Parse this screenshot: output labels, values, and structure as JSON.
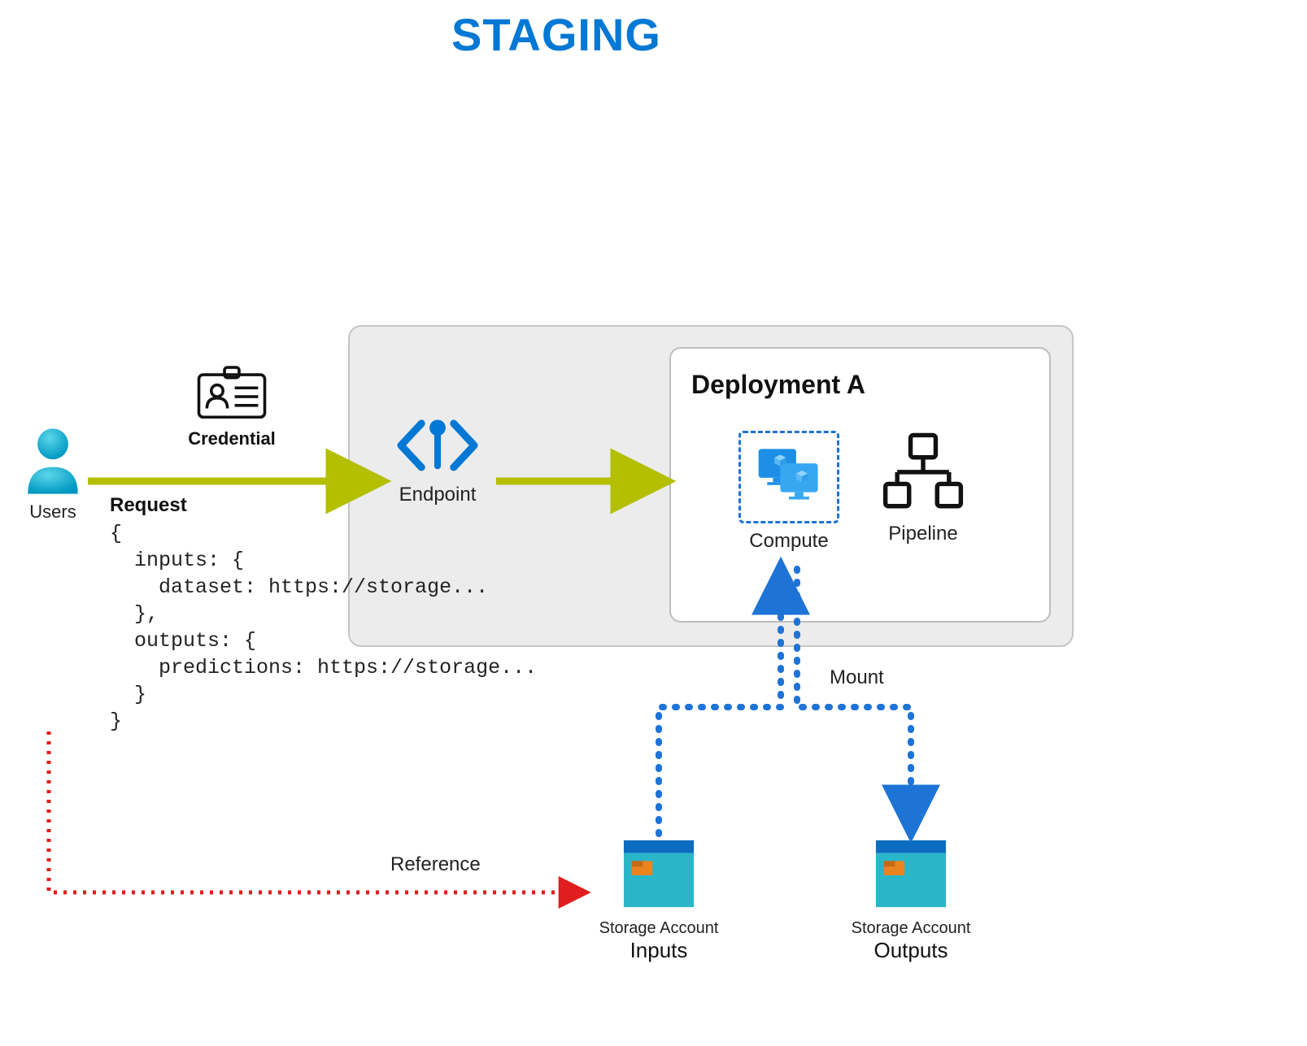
{
  "title": "STAGING",
  "users_label": "Users",
  "credential_label": "Credential",
  "endpoint_label": "Endpoint",
  "deployment_title": "Deployment A",
  "compute_label": "Compute",
  "pipeline_label": "Pipeline",
  "mount_label": "Mount",
  "reference_label": "Reference",
  "request_title": "Request",
  "request_body": "{\n  inputs: {\n    dataset: https://storage...\n  },\n  outputs: {\n    predictions: https://storage...\n  }\n}",
  "storage_in": {
    "top": "Storage Account",
    "bottom": "Inputs"
  },
  "storage_out": {
    "top": "Storage Account",
    "bottom": "Outputs"
  },
  "colors": {
    "accent_blue": "#0078D4",
    "olive_arrow": "#B3BF00",
    "red_dash": "#E01E1E",
    "blue_dash": "#1E73D6",
    "teal": "#2AB6C9"
  }
}
